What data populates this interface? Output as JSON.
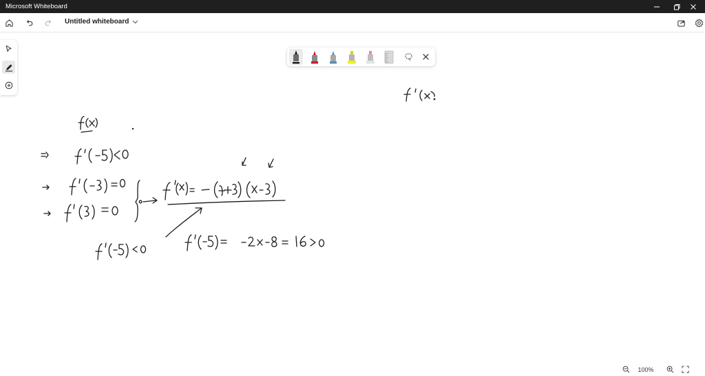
{
  "window": {
    "title": "Microsoft Whiteboard"
  },
  "toolbar": {
    "board_name": "Untitled whiteboard",
    "icons": [
      "home-icon",
      "undo-icon",
      "redo-icon",
      "chevron-down-icon",
      "share-icon",
      "settings-icon"
    ]
  },
  "left_rail": {
    "tools": [
      "select-icon",
      "pen-icon",
      "add-icon"
    ],
    "active": "pen-icon"
  },
  "pen_tray": {
    "pens": [
      {
        "name": "black-pen",
        "color": "#1a1a1a"
      },
      {
        "name": "red-pen",
        "color": "#d11b2f"
      },
      {
        "name": "blue-pen",
        "color": "#5b8fb5"
      },
      {
        "name": "yellow-highlighter",
        "color": "#f2ee1b"
      },
      {
        "name": "pink-highlighter",
        "color": "#e88aa0"
      },
      {
        "name": "ruler",
        "color": "#b9b9b9"
      }
    ],
    "selected": "black-pen",
    "icons": [
      "lasso-icon",
      "close-icon"
    ]
  },
  "zoom": {
    "level": "100%"
  }
}
